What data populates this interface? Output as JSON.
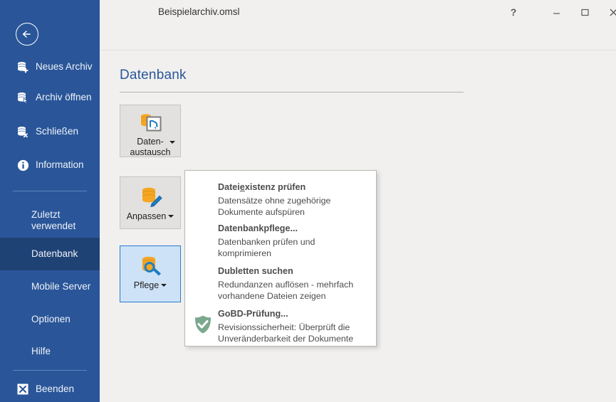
{
  "window": {
    "title": "Beispielarchiv.omsl",
    "controls": [
      {
        "name": "help",
        "glyph": "?"
      },
      {
        "name": "minimize",
        "glyph": "–"
      },
      {
        "name": "maximize",
        "glyph": "❑"
      },
      {
        "name": "close",
        "glyph": "✕"
      }
    ]
  },
  "sidebar": {
    "back_label": "back-arrow",
    "accent": "#2a5699",
    "selected_bg": "#1f4275",
    "items": [
      {
        "label": "Neues Archiv",
        "icon": "database-add-icon",
        "selected": false
      },
      {
        "label": "Archiv öffnen",
        "icon": "database-open-icon",
        "selected": false
      },
      {
        "label": "Schließen",
        "icon": "database-close-icon",
        "selected": false
      },
      {
        "label": "Information",
        "icon": "info-circle-icon",
        "selected": false
      },
      {
        "label": "Zuletzt\nverwendet",
        "icon": "",
        "selected": false
      },
      {
        "label": "Datenbank",
        "icon": "",
        "selected": true
      },
      {
        "label": "Mobile Server",
        "icon": "",
        "selected": false
      },
      {
        "label": "Optionen",
        "icon": "",
        "selected": false
      },
      {
        "label": "Hilfe",
        "icon": "",
        "selected": false
      },
      {
        "label": "Beenden",
        "icon": "exit-x-icon",
        "selected": false
      }
    ]
  },
  "main": {
    "page_title": "Datenbank",
    "page_title_color": "#2a5699",
    "buttons": [
      {
        "label": "Daten-\naustausch",
        "icon": "database-exchange-icon",
        "active": false,
        "caret": "corner"
      },
      {
        "label": "Anpassen",
        "icon": "database-edit-icon",
        "active": false,
        "caret": "inline"
      },
      {
        "label": "Pflege",
        "icon": "database-wrench-icon",
        "active": true,
        "caret": "inline"
      }
    ]
  },
  "dropdown": {
    "items": [
      {
        "title_pre": "Datei",
        "title_accel": "e",
        "title_post": "xistenz prüfen",
        "title_full": "Dateiexistenz prüfen",
        "desc": "Datensätze ohne zugehörige\nDokumente aufspüren",
        "icon": ""
      },
      {
        "title_full": "Datenbankpflege...",
        "desc": "Datenbanken prüfen und\nkomprimieren",
        "icon": ""
      },
      {
        "title_full": "Dubletten suchen",
        "desc": "Redundanzen auflösen - mehrfach\nvorhandene Dateien zeigen",
        "icon": ""
      },
      {
        "title_full": "GoBD-Prüfung...",
        "desc": "Revisionssicherheit: Überprüft die\nUnveränderbarkeit der Dokumente",
        "icon": "shield-check-icon"
      }
    ],
    "shield_color": "#7ba88f"
  }
}
